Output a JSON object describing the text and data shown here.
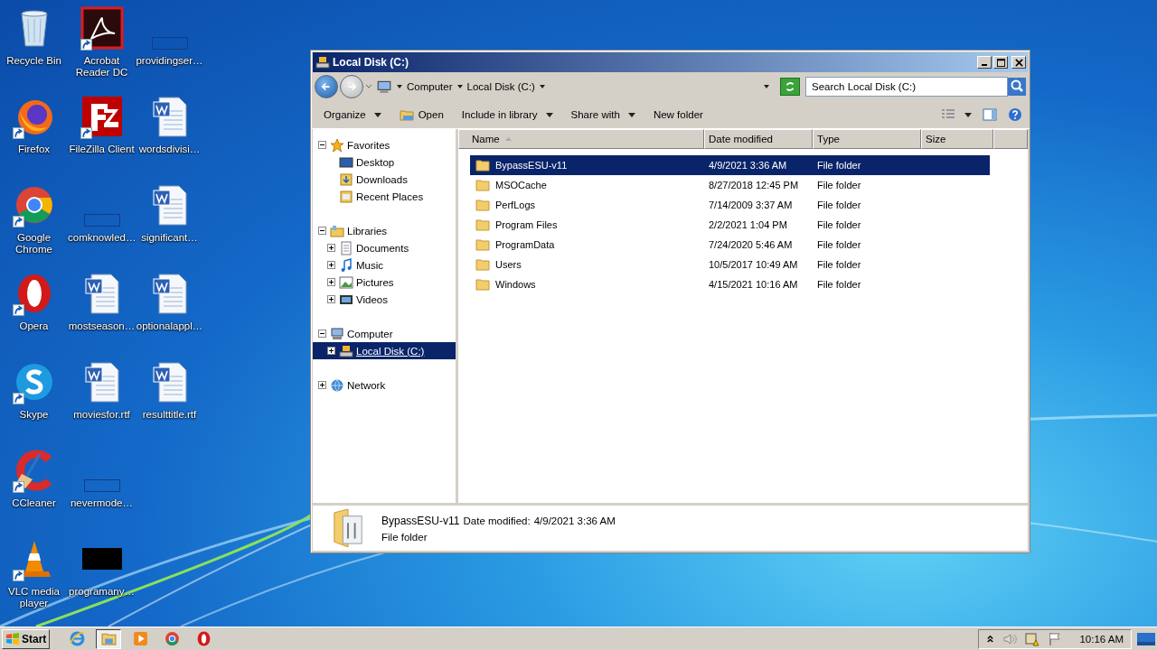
{
  "desktop_icons": [
    {
      "label": "Recycle Bin",
      "kind": "recycle",
      "shortcut": false
    },
    {
      "label": "Firefox",
      "kind": "firefox",
      "shortcut": true
    },
    {
      "label": "Google Chrome",
      "kind": "chrome",
      "shortcut": true
    },
    {
      "label": "Opera",
      "kind": "opera",
      "shortcut": true
    },
    {
      "label": "Skype",
      "kind": "skype",
      "shortcut": true
    },
    {
      "label": "CCleaner",
      "kind": "ccleaner",
      "shortcut": true
    },
    {
      "label": "VLC media player",
      "kind": "vlc",
      "shortcut": true
    },
    {
      "label": "Acrobat Reader DC",
      "kind": "acrobat",
      "shortcut": true
    },
    {
      "label": "FileZilla Client",
      "kind": "filezilla",
      "shortcut": true
    },
    {
      "label": "comknowled…",
      "kind": "blank",
      "shortcut": false
    },
    {
      "label": "mostseason…",
      "kind": "word",
      "shortcut": false
    },
    {
      "label": "moviesfor.rtf",
      "kind": "word",
      "shortcut": false
    },
    {
      "label": "nevermode…",
      "kind": "blank",
      "shortcut": false
    },
    {
      "label": "programany…",
      "kind": "black",
      "shortcut": false
    },
    {
      "label": "providingser…",
      "kind": "blank",
      "shortcut": false
    },
    {
      "label": "wordsdivisi…",
      "kind": "word",
      "shortcut": false
    },
    {
      "label": "significant…",
      "kind": "word",
      "shortcut": false
    },
    {
      "label": "optionalappl…",
      "kind": "word",
      "shortcut": false
    },
    {
      "label": "resulttitle.rtf",
      "kind": "word",
      "shortcut": false
    }
  ],
  "window": {
    "title": "Local Disk (C:)",
    "breadcrumb": [
      "Computer",
      "Local Disk (C:)"
    ],
    "search": {
      "placeholder": "Search Local Disk (C:)"
    },
    "toolbar": [
      {
        "label": "Organize",
        "kind": "menu"
      },
      {
        "label": "Open",
        "kind": "open"
      },
      {
        "label": "Include in library",
        "kind": "menu"
      },
      {
        "label": "Share with",
        "kind": "menu"
      },
      {
        "label": "New folder",
        "kind": "plain"
      }
    ],
    "nav_tree": [
      {
        "label": "Favorites",
        "kind": "star",
        "expanded": true,
        "selected": false,
        "children": [
          {
            "label": "Desktop",
            "kind": "desktop",
            "selected": false
          },
          {
            "label": "Downloads",
            "kind": "downloads",
            "selected": false
          },
          {
            "label": "Recent Places",
            "kind": "recent",
            "selected": false
          }
        ]
      },
      {
        "label": "Libraries",
        "kind": "library",
        "expanded": true,
        "selected": false,
        "children": [
          {
            "label": "Documents",
            "kind": "documents",
            "expanded": false,
            "selected": false
          },
          {
            "label": "Music",
            "kind": "music",
            "expanded": false,
            "selected": false
          },
          {
            "label": "Pictures",
            "kind": "pictures",
            "expanded": false,
            "selected": false
          },
          {
            "label": "Videos",
            "kind": "videos",
            "expanded": false,
            "selected": false
          }
        ]
      },
      {
        "label": "Computer",
        "kind": "computer",
        "expanded": true,
        "selected": false,
        "children": [
          {
            "label": "Local Disk (C:)",
            "kind": "disk",
            "expanded": false,
            "selected": true
          }
        ]
      },
      {
        "label": "Network",
        "kind": "network",
        "expanded": false,
        "selected": false
      }
    ],
    "table": {
      "columns": [
        "Name",
        "Date modified",
        "Type",
        "Size"
      ],
      "rows": [
        {
          "name": "BypassESU-v11",
          "date": "4/9/2021 3:36 AM",
          "type": "File folder",
          "selected": true
        },
        {
          "name": "MSOCache",
          "date": "8/27/2018 12:45 PM",
          "type": "File folder",
          "selected": false
        },
        {
          "name": "PerfLogs",
          "date": "7/14/2009 3:37 AM",
          "type": "File folder",
          "selected": false
        },
        {
          "name": "Program Files",
          "date": "2/2/2021 1:04 PM",
          "type": "File folder",
          "selected": false
        },
        {
          "name": "ProgramData",
          "date": "7/24/2020 5:46 AM",
          "type": "File folder",
          "selected": false
        },
        {
          "name": "Users",
          "date": "10/5/2017 10:49 AM",
          "type": "File folder",
          "selected": false
        },
        {
          "name": "Windows",
          "date": "4/15/2021 10:16 AM",
          "type": "File folder",
          "selected": false
        }
      ]
    },
    "details": {
      "name": "BypassESU-v11",
      "date_label": "Date modified:",
      "date": "4/9/2021 3:36 AM",
      "type": "File folder"
    }
  },
  "taskbar": {
    "start": "Start",
    "apps": [
      {
        "kind": "ie",
        "selected": false
      },
      {
        "kind": "explorer",
        "selected": true
      },
      {
        "kind": "media",
        "selected": false
      },
      {
        "kind": "chrome",
        "selected": false
      },
      {
        "kind": "opera",
        "selected": false
      }
    ],
    "clock": "10:16 AM"
  }
}
